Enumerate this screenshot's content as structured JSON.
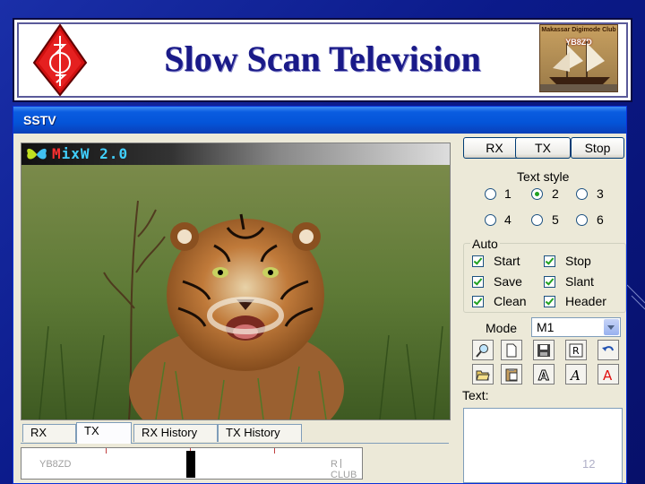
{
  "slide": {
    "title": "Slow Scan Television",
    "page_number": "12",
    "club_logo_name": "Makassar Digimode Club",
    "club_logo_call": "YB8ZD"
  },
  "window": {
    "title": "SSTV",
    "app_banner": {
      "first": "M",
      "rest": "ixW 2.0"
    },
    "tabs": [
      "RX",
      "TX",
      "RX History",
      "TX History"
    ],
    "active_tab": "TX",
    "strip": {
      "callsign": "YB8ZD",
      "club": "R CLUB"
    }
  },
  "controls": {
    "rx_button": "RX",
    "tx_button": "TX",
    "stop_button": "Stop",
    "text_style_label": "Text style",
    "text_styles": [
      "1",
      "2",
      "3",
      "4",
      "5",
      "6"
    ],
    "selected_style": "2",
    "auto_label": "Auto",
    "auto_options": [
      "Start",
      "Stop",
      "Save",
      "Slant",
      "Clean",
      "Header"
    ],
    "mode_label": "Mode",
    "mode_value": "M1",
    "text_label": "Text:"
  },
  "colors": {
    "accent": "#0454d8",
    "title_text": "#1a1a88",
    "check": "#21a121"
  }
}
